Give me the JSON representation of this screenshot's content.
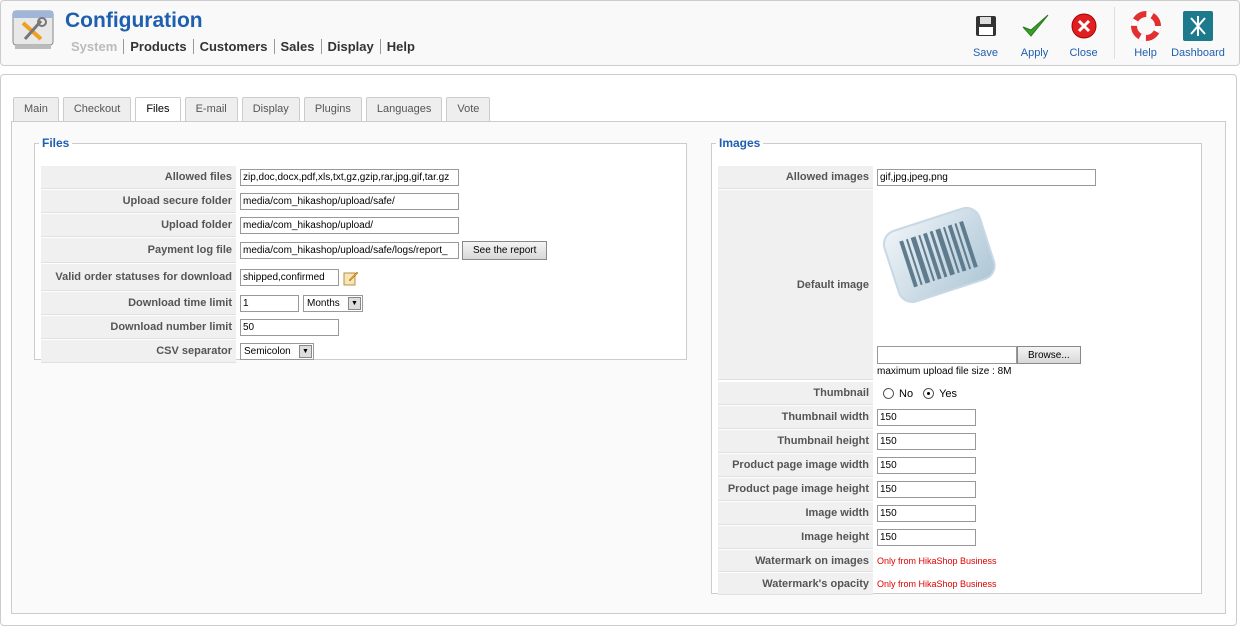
{
  "header": {
    "title": "Configuration",
    "menu": [
      "System",
      "Products",
      "Customers",
      "Sales",
      "Display",
      "Help"
    ]
  },
  "toolbar": {
    "save": "Save",
    "apply": "Apply",
    "close": "Close",
    "help": "Help",
    "dashboard": "Dashboard"
  },
  "tabs": [
    "Main",
    "Checkout",
    "Files",
    "E-mail",
    "Display",
    "Plugins",
    "Languages",
    "Vote"
  ],
  "active_tab": "Files",
  "files": {
    "legend": "Files",
    "allowed_files_label": "Allowed files",
    "allowed_files_value": "zip,doc,docx,pdf,xls,txt,gz,gzip,rar,jpg,gif,tar.gz",
    "upload_secure_label": "Upload secure folder",
    "upload_secure_value": "media/com_hikashop/upload/safe/",
    "upload_folder_label": "Upload folder",
    "upload_folder_value": "media/com_hikashop/upload/",
    "payment_log_label": "Payment log file",
    "payment_log_value": "media/com_hikashop/upload/safe/logs/report_",
    "see_report": "See the report",
    "valid_statuses_label": "Valid order statuses for download",
    "valid_statuses_value": "shipped,confirmed",
    "download_time_label": "Download time limit",
    "download_time_value": "1",
    "download_time_unit": "Months",
    "download_number_label": "Download number limit",
    "download_number_value": "50",
    "csv_label": "CSV separator",
    "csv_value": "Semicolon"
  },
  "images": {
    "legend": "Images",
    "allowed_images_label": "Allowed images",
    "allowed_images_value": "gif,jpg,jpeg,png",
    "default_image_label": "Default image",
    "browse": "Browse...",
    "max_upload": "maximum upload file size : 8M",
    "thumbnail_label": "Thumbnail",
    "thumbnail_no": "No",
    "thumbnail_yes": "Yes",
    "thumbnail_selected": "Yes",
    "thumb_width_label": "Thumbnail width",
    "thumb_width_value": "150",
    "thumb_height_label": "Thumbnail height",
    "thumb_height_value": "150",
    "pp_width_label": "Product page image width",
    "pp_width_value": "150",
    "pp_height_label": "Product page image height",
    "pp_height_value": "150",
    "img_width_label": "Image width",
    "img_width_value": "150",
    "img_height_label": "Image height",
    "img_height_value": "150",
    "watermark_label": "Watermark on images",
    "watermark_value": "Only from HikaShop Business",
    "watermark_opacity_label": "Watermark's opacity",
    "watermark_opacity_value": "Only from HikaShop Business"
  },
  "colors": {
    "title_blue": "#1f5fb0",
    "business_red": "#dd0000"
  }
}
